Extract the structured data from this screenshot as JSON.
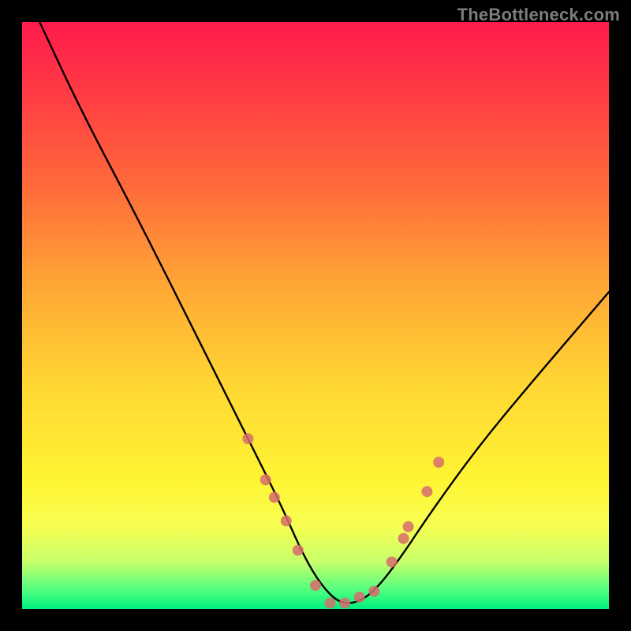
{
  "watermark": "TheBottleneck.com",
  "chart_data": {
    "type": "line",
    "title": "",
    "xlabel": "",
    "ylabel": "",
    "xlim": [
      0,
      100
    ],
    "ylim": [
      0,
      100
    ],
    "series": [
      {
        "name": "bottleneck-curve",
        "x": [
          3,
          10,
          20,
          30,
          38,
          44,
          48,
          51,
          54,
          57,
          60,
          64,
          70,
          78,
          88,
          100
        ],
        "y": [
          100,
          85,
          66,
          46,
          30,
          18,
          9,
          4,
          1,
          1,
          3,
          8,
          17,
          28,
          40,
          54
        ]
      }
    ],
    "markers": {
      "name": "highlight-dots",
      "color": "#d76c6c",
      "points": [
        {
          "x": 38.5,
          "y": 29
        },
        {
          "x": 41.5,
          "y": 22
        },
        {
          "x": 43.0,
          "y": 19
        },
        {
          "x": 45.0,
          "y": 15
        },
        {
          "x": 47.0,
          "y": 10
        },
        {
          "x": 50.0,
          "y": 4
        },
        {
          "x": 52.5,
          "y": 1
        },
        {
          "x": 55.0,
          "y": 1
        },
        {
          "x": 57.5,
          "y": 2
        },
        {
          "x": 60.0,
          "y": 3
        },
        {
          "x": 63.0,
          "y": 8
        },
        {
          "x": 65.0,
          "y": 12
        },
        {
          "x": 65.8,
          "y": 14
        },
        {
          "x": 69.0,
          "y": 20
        },
        {
          "x": 71.0,
          "y": 25
        }
      ]
    },
    "gradient_stops": [
      {
        "pos": 0,
        "color": "#ff1b4d"
      },
      {
        "pos": 12,
        "color": "#ff3b44"
      },
      {
        "pos": 28,
        "color": "#ff6a3a"
      },
      {
        "pos": 45,
        "color": "#ffa735"
      },
      {
        "pos": 62,
        "color": "#ffd733"
      },
      {
        "pos": 78,
        "color": "#fff433"
      },
      {
        "pos": 86,
        "color": "#f6ff52"
      },
      {
        "pos": 92,
        "color": "#c7ff6a"
      },
      {
        "pos": 97,
        "color": "#4cff80"
      },
      {
        "pos": 100,
        "color": "#00f07e"
      }
    ]
  }
}
